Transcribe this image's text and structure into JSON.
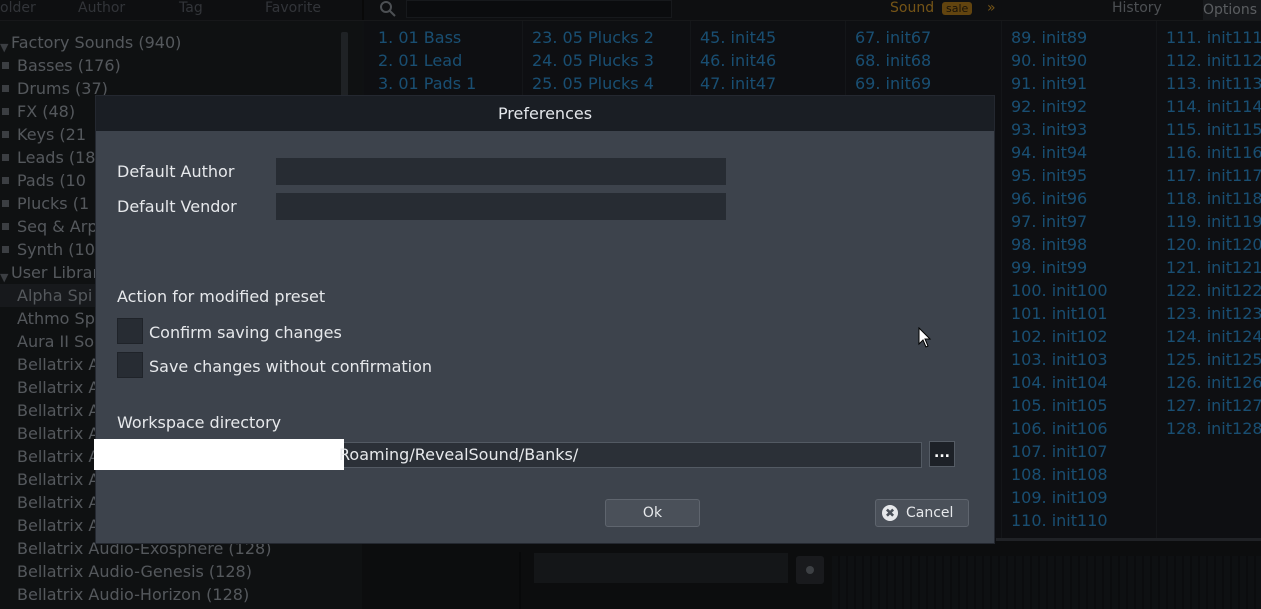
{
  "top_tabs": [
    "older",
    "Author",
    "Tag",
    "Favorite"
  ],
  "sound_label": "Sound",
  "sale_badge": "sale",
  "sale_arrows": "»",
  "history_label": "History",
  "options_label": "Options",
  "tree": [
    {
      "label": "Factory Sounds  (940)",
      "type": "root"
    },
    {
      "label": "Basses  (176)",
      "type": "item"
    },
    {
      "label": "Drums  (37)",
      "type": "item"
    },
    {
      "label": "FX  (48)",
      "type": "item"
    },
    {
      "label": "Keys  (21",
      "type": "item"
    },
    {
      "label": "Leads  (18",
      "type": "item"
    },
    {
      "label": "Pads  (10",
      "type": "item"
    },
    {
      "label": "Plucks  (1",
      "type": "item"
    },
    {
      "label": "Seq & Arp",
      "type": "item"
    },
    {
      "label": "Synth  (10",
      "type": "item"
    },
    {
      "label": "User Librar",
      "type": "root"
    },
    {
      "label": "Alpha Spi",
      "type": "selected"
    },
    {
      "label": "Athmo Sp",
      "type": "plain"
    },
    {
      "label": "Aura II So",
      "type": "plain"
    },
    {
      "label": "Bellatrix A",
      "type": "plain"
    },
    {
      "label": "Bellatrix A",
      "type": "plain"
    },
    {
      "label": "Bellatrix A",
      "type": "plain"
    },
    {
      "label": "Bellatrix A",
      "type": "plain"
    },
    {
      "label": "Bellatrix A",
      "type": "plain"
    },
    {
      "label": "Bellatrix A",
      "type": "plain"
    },
    {
      "label": "Bellatrix A",
      "type": "plain"
    },
    {
      "label": "Bellatrix A",
      "type": "plain"
    },
    {
      "label": "Bellatrix Audio-Exosphere  (128)",
      "type": "plain"
    },
    {
      "label": "Bellatrix Audio-Genesis  (128)",
      "type": "plain"
    },
    {
      "label": "Bellatrix Audio-Horizon  (128)",
      "type": "plain"
    }
  ],
  "grid_columns": [
    [
      "1. 01 Bass",
      "2. 01 Lead",
      "3. 01 Pads 1"
    ],
    [
      "23. 05 Plucks 2",
      "24. 05 Plucks 3",
      "25. 05 Plucks 4"
    ],
    [
      "45. init45",
      "46. init46",
      "47. init47"
    ],
    [
      "67. init67",
      "68. init68",
      "69. init69"
    ],
    [
      "89. init89",
      "90. init90",
      "91. init91",
      "92. init92",
      "93. init93",
      "94. init94",
      "95. init95",
      "96. init96",
      "97. init97",
      "98. init98",
      "99. init99",
      "100. init100",
      "101. init101",
      "102. init102",
      "103. init103",
      "104. init104",
      "105. init105",
      "106. init106",
      "107. init107",
      "108. init108",
      "109. init109",
      "110. init110"
    ],
    [
      "111. init111",
      "112. init112",
      "113. init113",
      "114. init114",
      "115. init115",
      "116. init116",
      "117. init117",
      "118. init118",
      "119. init119",
      "120. init120",
      "121. init121",
      "122. init122",
      "123. init123",
      "124. init124",
      "125. init125",
      "126. init126",
      "127. init127",
      "128. init128"
    ]
  ],
  "dialog": {
    "title": "Preferences",
    "default_author_label": "Default Author",
    "default_author_value": "",
    "default_vendor_label": "Default Vendor",
    "default_vendor_value": "",
    "action_heading": "Action for modified preset",
    "confirm_label": "Confirm saving changes",
    "no_confirm_label": "Save changes without confirmation",
    "workspace_heading": "Workspace directory",
    "workspace_path": "Roaming/RevealSound/Banks/",
    "browse_label": "...",
    "ok_label": "Ok",
    "cancel_label": "Cancel",
    "cancel_icon": "✖"
  },
  "colors": {
    "accent_blue": "#2e8fd0",
    "sale_orange": "#d59a2a",
    "dialog_bg": "#3d434c"
  }
}
